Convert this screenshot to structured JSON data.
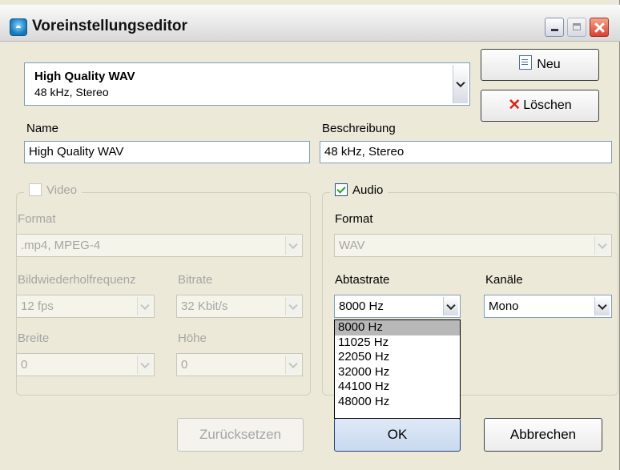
{
  "window": {
    "title": "Voreinstellungseditor"
  },
  "preset": {
    "name": "High Quality WAV",
    "description": "48 kHz, Stereo"
  },
  "buttons": {
    "new": "Neu",
    "delete": "Löschen",
    "reset": "Zurücksetzen",
    "ok": "OK",
    "cancel": "Abbrechen"
  },
  "fields": {
    "name_label": "Name",
    "name_value": "High Quality WAV",
    "description_label": "Beschreibung",
    "description_value": "48 kHz, Stereo"
  },
  "video": {
    "label": "Video",
    "checked": false,
    "format_label": "Format",
    "format_value": ".mp4, MPEG-4",
    "framerate_label": "Bildwiederholfrequenz",
    "framerate_value": "12 fps",
    "bitrate_label": "Bitrate",
    "bitrate_value": "32 Kbit/s",
    "width_label": "Breite",
    "width_value": "0",
    "height_label": "Höhe",
    "height_value": "0"
  },
  "audio": {
    "label": "Audio",
    "checked": true,
    "format_label": "Format",
    "format_value": "WAV",
    "samplerate_label": "Abtastrate",
    "samplerate_value": "8000 Hz",
    "channels_label": "Kanäle",
    "channels_value": "Mono",
    "samplerate_options": [
      "8000 Hz",
      "11025 Hz",
      "22050 Hz",
      "32000 Hz",
      "44100 Hz",
      "48000 Hz"
    ]
  }
}
